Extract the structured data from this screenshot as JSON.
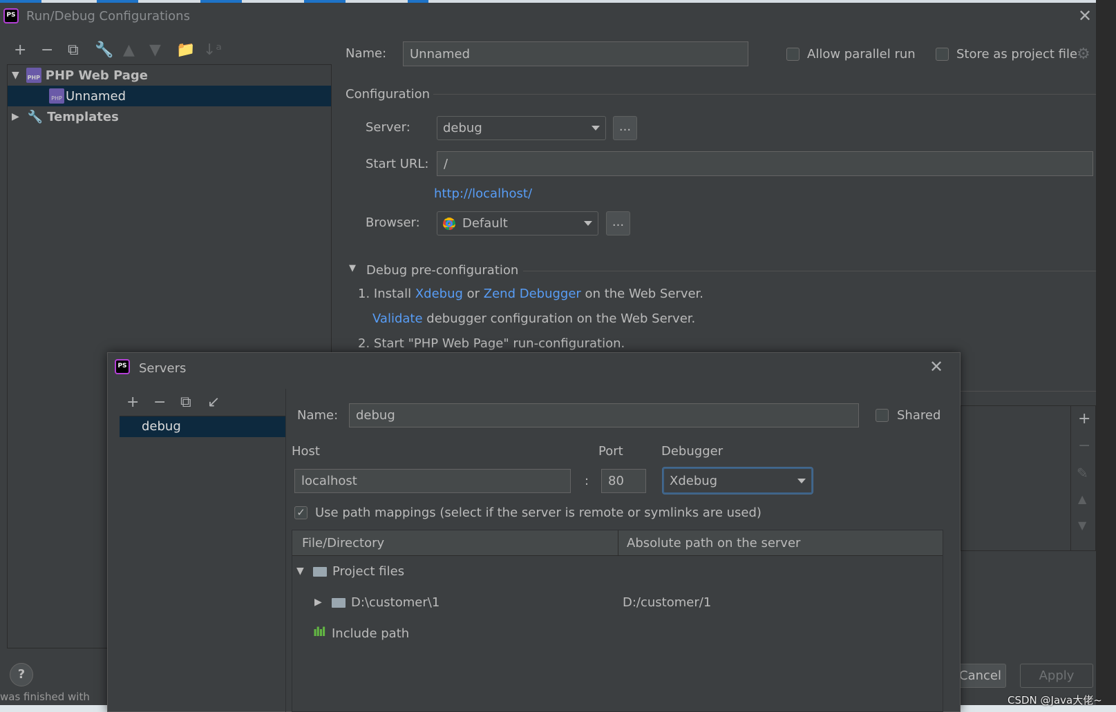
{
  "main_dialog": {
    "title": "Run/Debug Configurations",
    "toolbar": [
      "add-icon",
      "remove-icon",
      "copy-icon",
      "wrench-icon",
      "move-up-icon",
      "move-down-icon",
      "new-folder-icon",
      "sort-icon"
    ],
    "tree": {
      "group": "PHP Web Page",
      "item": "Unnamed",
      "templates": "Templates"
    },
    "name_label": "Name:",
    "name_value": "Unnamed",
    "allow_parallel": "Allow parallel run",
    "store_project": "Store as project file",
    "configuration": "Configuration",
    "server_label": "Server:",
    "server_value": "debug",
    "ellipsis": "...",
    "start_url_label": "Start URL:",
    "start_url_value": "/",
    "url_link": "http://localhost/",
    "browser_label": "Browser:",
    "browser_value": "Default",
    "debug_section": "Debug pre-configuration",
    "step1_prefix": "1. Install ",
    "xdebug": "Xdebug",
    "or": " or ",
    "zend": "Zend Debugger",
    "step1_suffix": " on the Web Server.",
    "validate": "Validate",
    "validate_suffix": " debugger configuration on the Web Server.",
    "step2": "2. Start \"PHP Web Page\" run-configuration.",
    "cancel": "Cancel",
    "cancel_visible": "ancel",
    "apply": "Apply",
    "help": "?"
  },
  "servers_dialog": {
    "title": "Servers",
    "servers": [
      "debug"
    ],
    "name_label": "Name:",
    "name_value": "debug",
    "shared": "Shared",
    "host_label": "Host",
    "port_label": "Port",
    "debugger_label": "Debugger",
    "host_value": "localhost",
    "colon": ":",
    "port_value": "80",
    "debugger_value": "Xdebug",
    "use_mappings": "Use path mappings (select if the server is remote or symlinks are used)",
    "use_mappings_checked": true,
    "columns": [
      "File/Directory",
      "Absolute path on the server"
    ],
    "rows": [
      {
        "file": "Project files",
        "server": ""
      },
      {
        "file": "D:\\customer\\1",
        "server": "D:/customer/1"
      },
      {
        "file": "Include path",
        "server": ""
      }
    ]
  },
  "background": {
    "status_text": "was finished with",
    "watermark": "CSDN @Java大佬~"
  }
}
